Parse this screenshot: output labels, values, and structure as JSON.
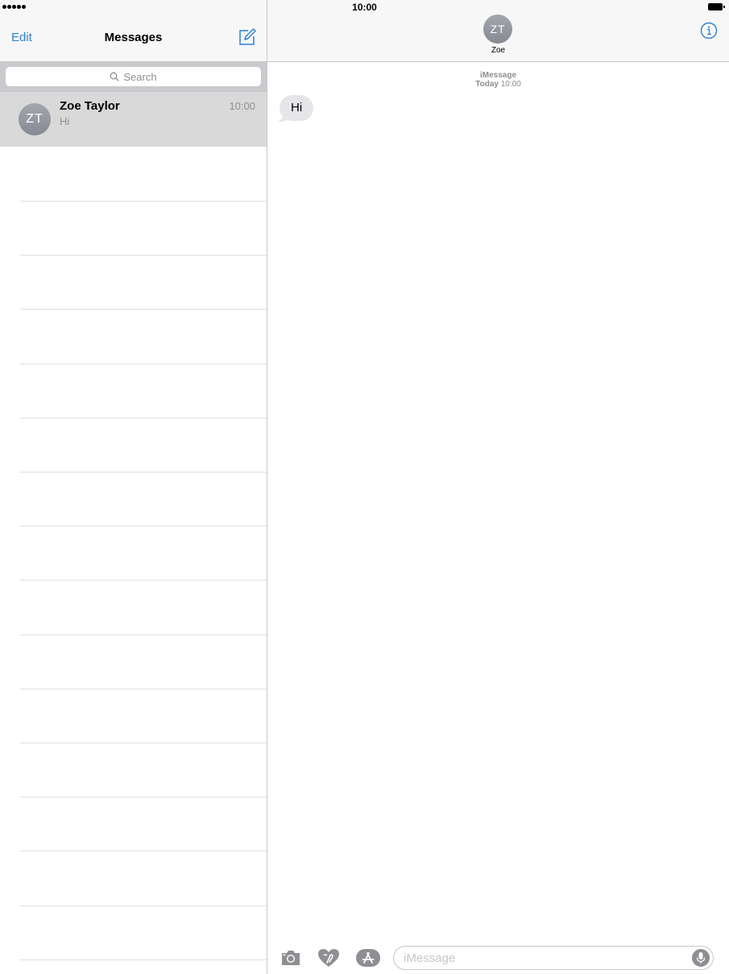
{
  "status_bar": {
    "time": "10:00",
    "signal_icon": "signal-dots-icon",
    "battery_icon": "battery-icon"
  },
  "sidebar": {
    "edit_label": "Edit",
    "title": "Messages",
    "compose_icon": "compose-icon",
    "search": {
      "placeholder": "Search",
      "icon": "search-icon"
    },
    "conversations": [
      {
        "initials": "ZT",
        "name": "Zoe Taylor",
        "time": "10:00",
        "preview": "Hi"
      }
    ]
  },
  "conversation": {
    "contact_initials": "ZT",
    "contact_name": "Zoe",
    "info_icon": "info-icon",
    "service_label": "iMessage",
    "timestamp_day": "Today",
    "timestamp_time": "10:00",
    "messages": [
      {
        "direction": "incoming",
        "text": "Hi"
      }
    ],
    "input": {
      "placeholder": "iMessage"
    },
    "toolbar_icons": [
      "camera-icon",
      "digital-touch-icon",
      "app-store-icon",
      "microphone-icon"
    ]
  },
  "colors": {
    "accent": "#2f80d1",
    "bubble_incoming": "#e5e5ea",
    "selected_row": "#d9d9d9",
    "nav_bg": "#f7f7f7"
  }
}
